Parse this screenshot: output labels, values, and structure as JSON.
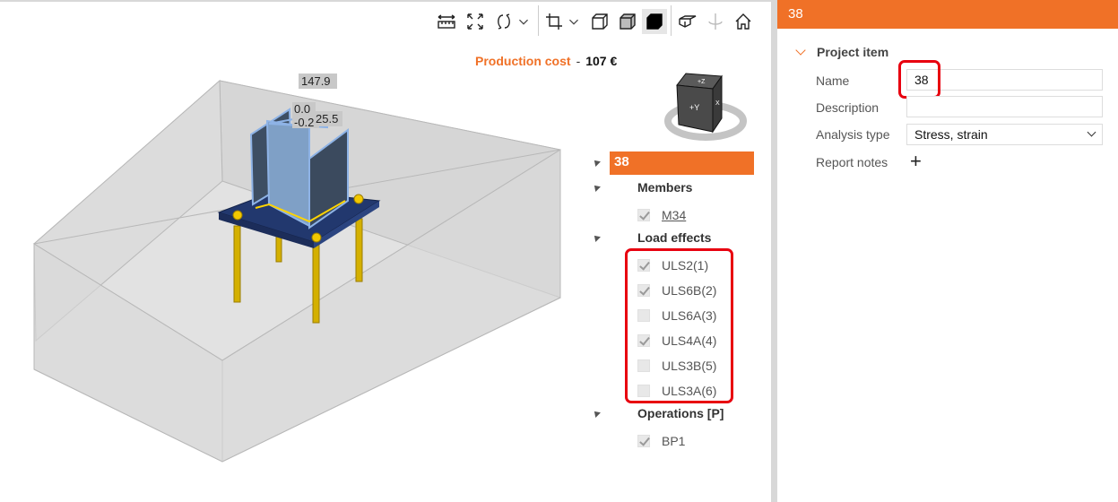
{
  "toolbar": {
    "icons": [
      "measure-icon",
      "fit-view-icon",
      "rotate-icon",
      "dropdown",
      "crop-icon",
      "dropdown",
      "wireframe-icon",
      "transparent-icon",
      "solid-icon",
      "section-icon",
      "rotate-axis-icon",
      "home-icon"
    ]
  },
  "cost": {
    "label": "Production cost",
    "separator": "-",
    "value": "107 €"
  },
  "view_cube": {
    "top": "+Z",
    "front": "+Y",
    "side": "X"
  },
  "dimensions": [
    "147.9",
    "0.0",
    "-0.2",
    "25.5"
  ],
  "tree": {
    "title": "38",
    "groups": [
      {
        "label": "Members",
        "items": [
          {
            "label": "M34",
            "checked": true
          }
        ]
      },
      {
        "label": "Load effects",
        "items": [
          {
            "label": "ULS2(1)",
            "checked": true
          },
          {
            "label": "ULS6B(2)",
            "checked": true
          },
          {
            "label": "ULS6A(3)",
            "checked": false
          },
          {
            "label": "ULS4A(4)",
            "checked": true
          },
          {
            "label": "ULS3B(5)",
            "checked": false
          },
          {
            "label": "ULS3A(6)",
            "checked": false
          }
        ]
      },
      {
        "label": "Operations [P]",
        "items": [
          {
            "label": "BP1",
            "checked": true
          }
        ]
      }
    ]
  },
  "panel": {
    "header": "38",
    "section": "Project item",
    "name_label": "Name",
    "name_value": "38",
    "description_label": "Description",
    "description_value": "",
    "analysis_label": "Analysis type",
    "analysis_value": "Stress, strain",
    "notes_label": "Report notes",
    "notes_add": "+"
  },
  "colors": {
    "accent": "#f07127",
    "highlight": "#e8000f"
  }
}
